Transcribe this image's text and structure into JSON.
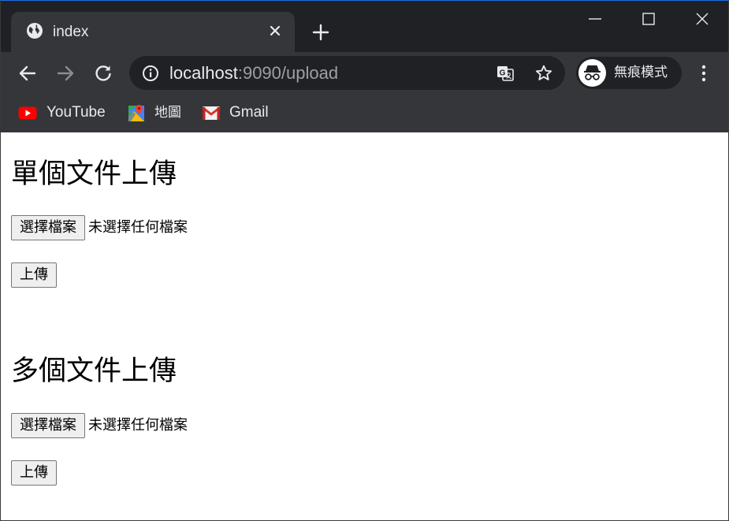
{
  "browser": {
    "tab": {
      "title": "index",
      "favicon": "globe-icon"
    },
    "toolbar": {
      "url_host": "localhost",
      "url_rest": ":9090/upload",
      "profile_label": "無痕模式"
    },
    "bookmarks": [
      {
        "label": "YouTube",
        "icon": "youtube-icon"
      },
      {
        "label": "地圖",
        "icon": "maps-icon"
      },
      {
        "label": "Gmail",
        "icon": "gmail-icon"
      }
    ],
    "colors": {
      "tabstrip": "#202124",
      "toolbar": "#35363a",
      "omnibox": "#202124",
      "text": "#e8eaed",
      "muted": "#9aa0a6"
    }
  },
  "page": {
    "single_upload": {
      "heading": "單個文件上傳",
      "choose_button": "選擇檔案",
      "no_file_text": "未選擇任何檔案",
      "submit_button": "上傳"
    },
    "multi_upload": {
      "heading": "多個文件上傳",
      "choose_button": "選擇檔案",
      "no_file_text": "未選擇任何檔案",
      "submit_button": "上傳"
    }
  }
}
